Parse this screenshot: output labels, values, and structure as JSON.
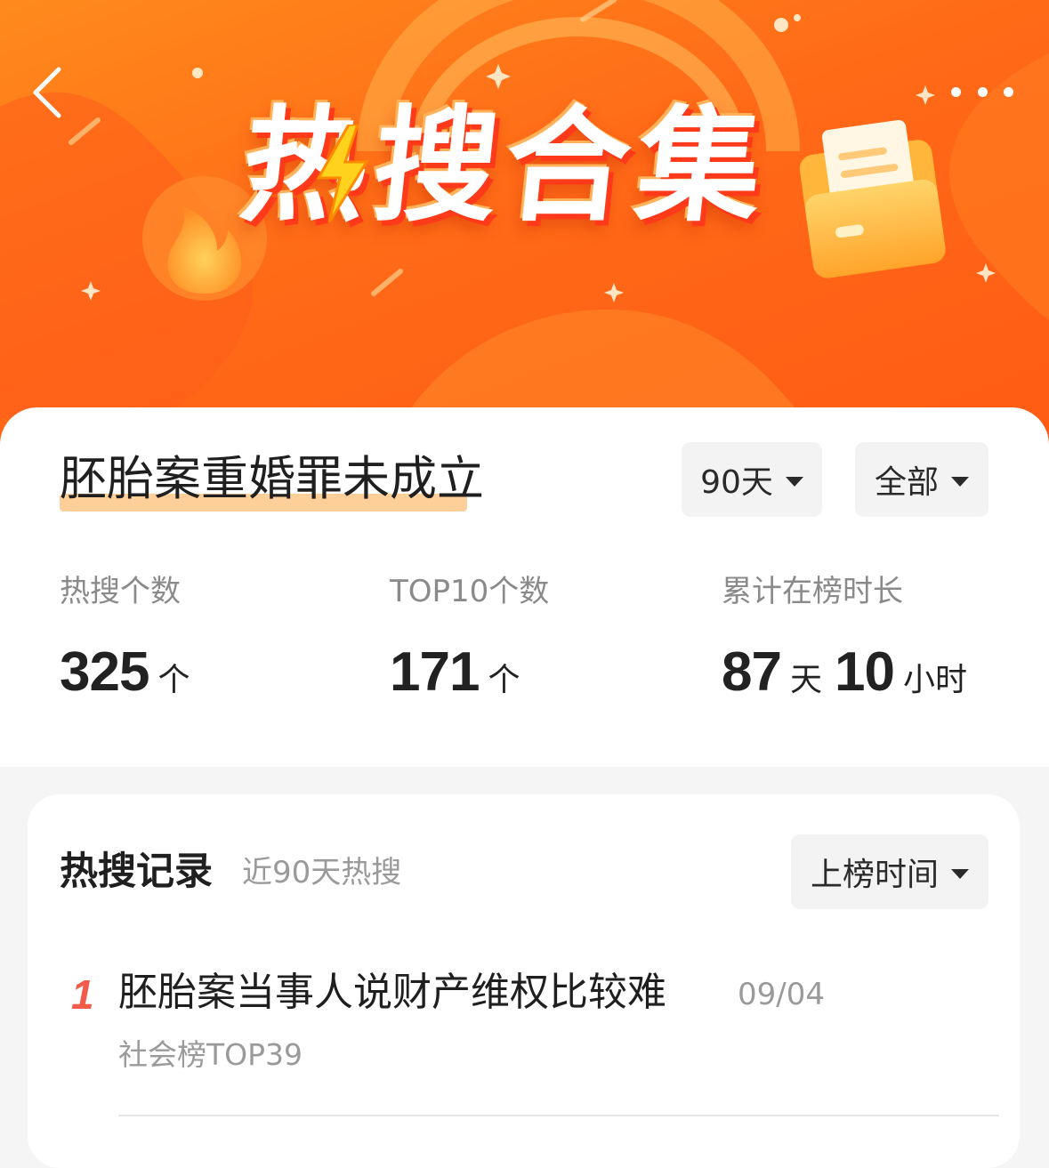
{
  "banner": {
    "title": "热搜合集"
  },
  "topic": {
    "title": "胚胎案重婚罪未成立"
  },
  "filters": {
    "period": "90天",
    "scope": "全部"
  },
  "stats": [
    {
      "label": "热搜个数",
      "value": "325",
      "unit": "个"
    },
    {
      "label": "TOP10个数",
      "value": "171",
      "unit": "个"
    },
    {
      "label": "累计在榜时长",
      "days": "87",
      "days_unit": "天",
      "hours": "10",
      "hours_unit": "小时"
    }
  ],
  "records": {
    "title": "热搜记录",
    "subtitle": "近90天热搜",
    "sort": "上榜时间",
    "items": [
      {
        "rank": "1",
        "title": "胚胎案当事人说财产维权比较难",
        "date": "09/04",
        "tag": "社会榜TOP39"
      }
    ]
  },
  "colors": {
    "banner_orange": "#ff6a17",
    "highlight": "#ffcf9a",
    "rank_red": "#f25a49"
  },
  "icons": [
    "back-arrow-icon",
    "more-dots-icon",
    "flame-icon",
    "lightning-icon",
    "folder-icon",
    "dropdown-caret-icon"
  ]
}
